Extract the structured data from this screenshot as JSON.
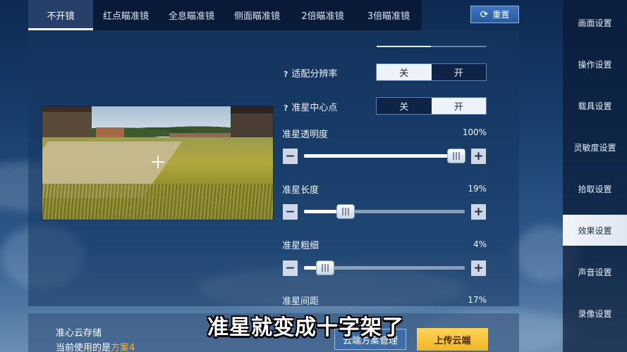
{
  "tabs": [
    {
      "label": "不开镜",
      "active": true
    },
    {
      "label": "红点瞄准镜",
      "active": false
    },
    {
      "label": "全息瞄准镜",
      "active": false
    },
    {
      "label": "侧面瞄准镜",
      "active": false
    },
    {
      "label": "2倍瞄准镜",
      "active": false
    },
    {
      "label": "3倍瞄准镜",
      "active": false
    }
  ],
  "reset_button": {
    "label": "重置",
    "icon": "refresh-icon"
  },
  "settings": {
    "resolution": {
      "label": "适配分辨率",
      "off": "关",
      "on": "开",
      "selected": "关",
      "help": "?"
    },
    "center_dot": {
      "label": "准星中心点",
      "off": "关",
      "on": "开",
      "selected": "开",
      "help": "?"
    },
    "opacity": {
      "label": "准星透明度",
      "value": "100%",
      "level": 1.0
    },
    "length": {
      "label": "准星长度",
      "value": "19%",
      "level": 0.19
    },
    "thickness": {
      "label": "准星粗细",
      "value": "4%",
      "level": 0.04
    },
    "gap": {
      "label": "准星间距",
      "value": "17%"
    }
  },
  "sidebar": {
    "items": [
      {
        "label": "画面设置",
        "active": false
      },
      {
        "label": "操作设置",
        "active": false
      },
      {
        "label": "载具设置",
        "active": false
      },
      {
        "label": "灵敏度设置",
        "active": false
      },
      {
        "label": "拾取设置",
        "active": false
      },
      {
        "label": "效果设置",
        "active": true
      },
      {
        "label": "声音设置",
        "active": false
      },
      {
        "label": "录像设置",
        "active": false
      }
    ]
  },
  "cloud": {
    "title": "准心云存储",
    "current_prefix": "当前使用的是",
    "current_plan": "方案4",
    "manage_label": "云端方案管理",
    "upload_label": "上传云端"
  },
  "caption": "准星就变成十字架了",
  "colors": {
    "accent": "#f0b522",
    "plan": "#f4b53a"
  }
}
